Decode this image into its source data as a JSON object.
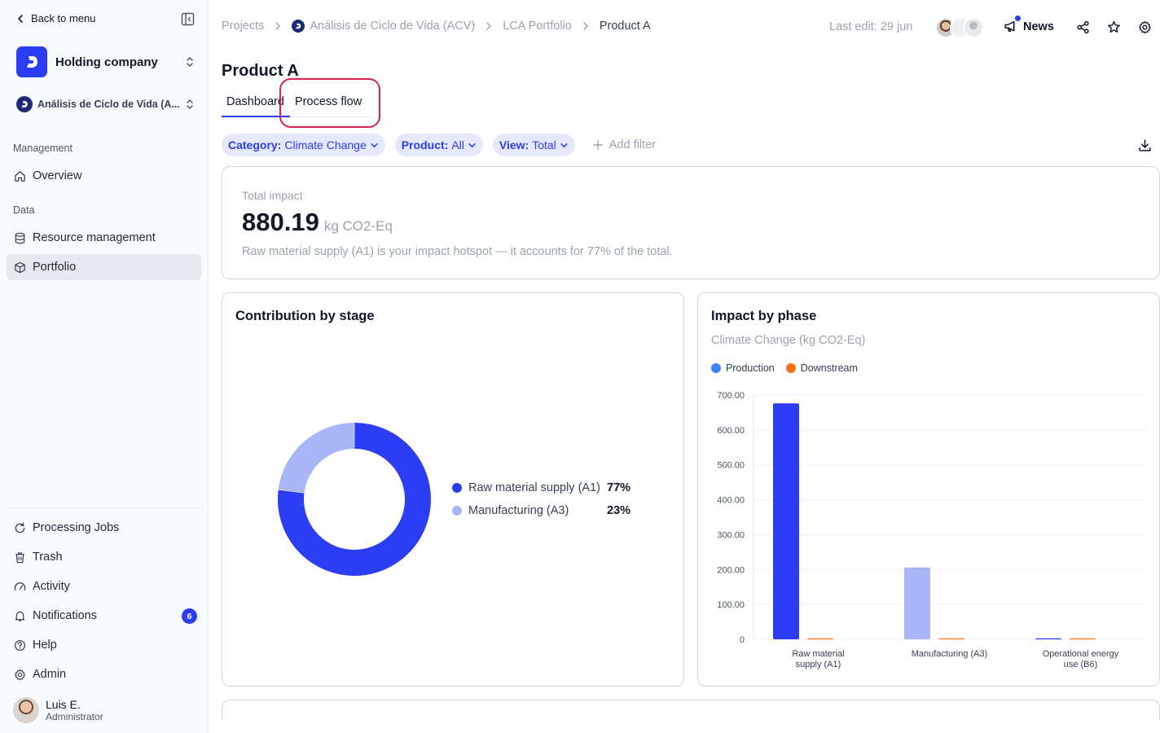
{
  "sidebar": {
    "back_label": "Back to menu",
    "org_name": "Holding company",
    "project_name": "Análisis de Ciclo de Vida (A...",
    "section_management": "Management",
    "section_data": "Data",
    "nav": {
      "overview": "Overview",
      "resource_management": "Resource management",
      "portfolio": "Portfolio",
      "processing_jobs": "Processing Jobs",
      "trash": "Trash",
      "activity": "Activity",
      "notifications": "Notifications",
      "help": "Help",
      "admin": "Admin"
    },
    "notifications_count": "6",
    "user": {
      "name": "Luis E.",
      "role": "Administrator"
    }
  },
  "header": {
    "breadcrumb": [
      "Projects",
      "Análisis de Ciclo de Vida (ACV)",
      "LCA Portfolio",
      "Product A"
    ],
    "last_edit": "Last edit: 29 jun",
    "news_label": "News"
  },
  "page": {
    "title": "Product A",
    "tabs": [
      "Dashboard",
      "Process flow"
    ],
    "active_tab": "Dashboard"
  },
  "filters": {
    "category_key": "Category:",
    "category_value": "Climate Change",
    "product_key": "Product:",
    "product_value": "All",
    "view_key": "View:",
    "view_value": "Total",
    "add_filter": "Add filter"
  },
  "total": {
    "label": "Total impact",
    "value": "880.19",
    "unit": "kg CO2-Eq",
    "note": "Raw material supply (A1) is your impact hotspot — it accounts for 77% of the total."
  },
  "colors": {
    "accent": "#2c3ef5",
    "light_blue": "#a9b6f7",
    "production": "#3b82f6",
    "downstream": "#f97316",
    "highlight_ring": "#d9234f"
  },
  "chart_data": [
    {
      "type": "pie",
      "title": "Contribution by stage",
      "donut": true,
      "categories": [
        "Raw material supply (A1)",
        "Manufacturing (A3)"
      ],
      "values": [
        77,
        23
      ],
      "labels": [
        "77%",
        "23%"
      ],
      "colors": [
        "#2c3ef5",
        "#a9b6f7"
      ],
      "legend": "right"
    },
    {
      "type": "bar",
      "title": "Impact by phase",
      "subtitle": "Climate Change (kg CO2-Eq)",
      "categories": [
        "Raw material supply (A1)",
        "Manufacturing (A3)",
        "Operational energy use (B6)"
      ],
      "series": [
        {
          "name": "Production",
          "values": [
            676,
            206,
            0
          ]
        },
        {
          "name": "Downstream",
          "values": [
            0,
            0,
            0
          ]
        }
      ],
      "bar_colors": [
        [
          "#2c3ef5",
          "#a9b6f7",
          "#2c3ef5"
        ],
        [
          "#f97316",
          "#f97316",
          "#f97316"
        ]
      ],
      "legend_colors": [
        "#3b82f6",
        "#f97316"
      ],
      "ylim": [
        0,
        700
      ],
      "yticks": [
        "0",
        "100.00",
        "200.00",
        "300.00",
        "400.00",
        "500.00",
        "600.00",
        "700.00"
      ],
      "legend": "top-left",
      "grid": true
    }
  ]
}
